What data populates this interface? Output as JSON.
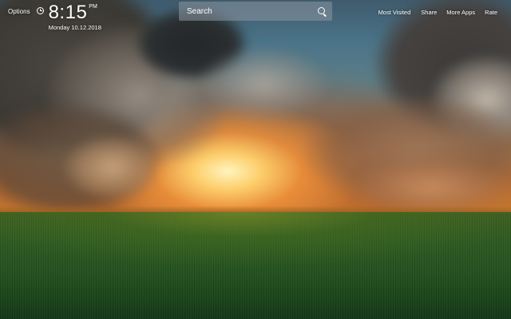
{
  "header": {
    "options_label": "Options",
    "clock_icon": "clock-icon",
    "time": "8:15",
    "ampm": "PM",
    "date": "Monday  10.12.2018"
  },
  "search": {
    "placeholder": "Search",
    "icon": "search-icon"
  },
  "nav": {
    "items": [
      {
        "label": "Most Visited"
      },
      {
        "label": "Share"
      },
      {
        "label": "More Apps"
      },
      {
        "label": "Rate"
      }
    ]
  },
  "background": {
    "description_colors": {
      "sky_top": "#4b7488",
      "sun": "#ffd46e",
      "field": "#255220"
    }
  }
}
